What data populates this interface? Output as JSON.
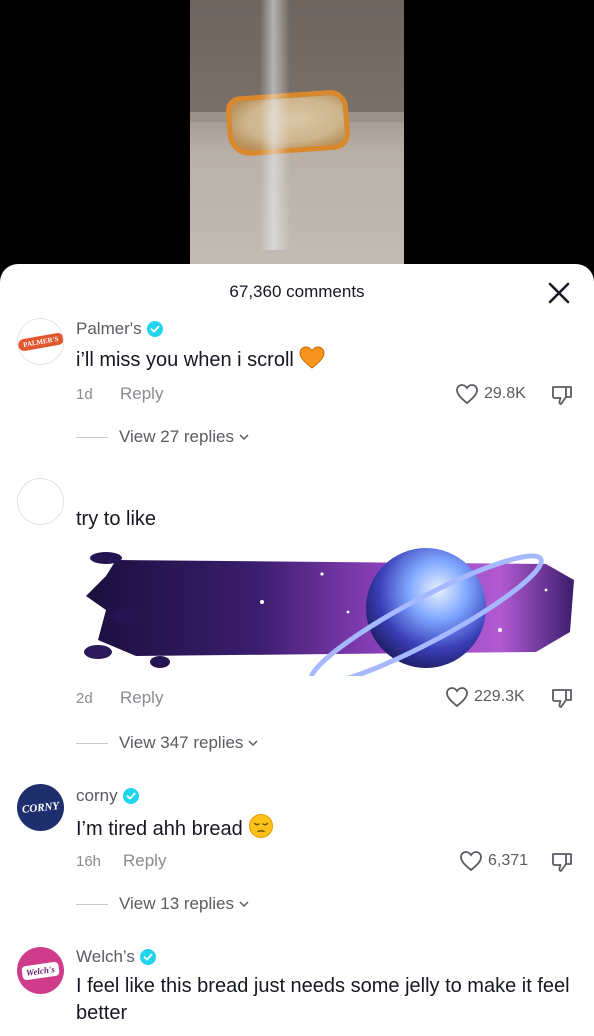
{
  "header": {
    "comment_count": "67,360 comments"
  },
  "comments": [
    {
      "username": "Palmer's",
      "verified": true,
      "avatar": "palmers-logo",
      "avatar_text": "PALMER'S",
      "text": "i’ll miss you when i scroll",
      "emoji": "orange-heart",
      "time": "1d",
      "reply_label": "Reply",
      "likes": "29.8K",
      "view_replies": "View 27 replies"
    },
    {
      "username": "",
      "verified": false,
      "avatar": "blank",
      "text": "try to like",
      "sticker": "pixel-planet-space-sticker",
      "time": "2d",
      "reply_label": "Reply",
      "likes": "229.3K",
      "view_replies": "View 347 replies"
    },
    {
      "username": "corny",
      "verified": true,
      "avatar": "corny-logo",
      "avatar_text": "CORNY",
      "text": "I’m tired ahh bread",
      "emoji": "pensive-face",
      "time": "16h",
      "reply_label": "Reply",
      "likes": "6,371",
      "view_replies": "View 13 replies"
    },
    {
      "username": "Welch’s",
      "verified": true,
      "avatar": "welchs-logo",
      "avatar_text": "Welch's",
      "text": "I feel like this bread just needs some jelly to make it feel better",
      "time": "",
      "reply_label": "",
      "likes": ""
    }
  ],
  "colors": {
    "verified": "#20d5ec",
    "text_primary": "#161823",
    "text_secondary": "#8a8b91",
    "palmers_brand": "#e2582e",
    "corny_brand": "#1f2f6e",
    "welchs_brand": "#cf3c8c"
  }
}
